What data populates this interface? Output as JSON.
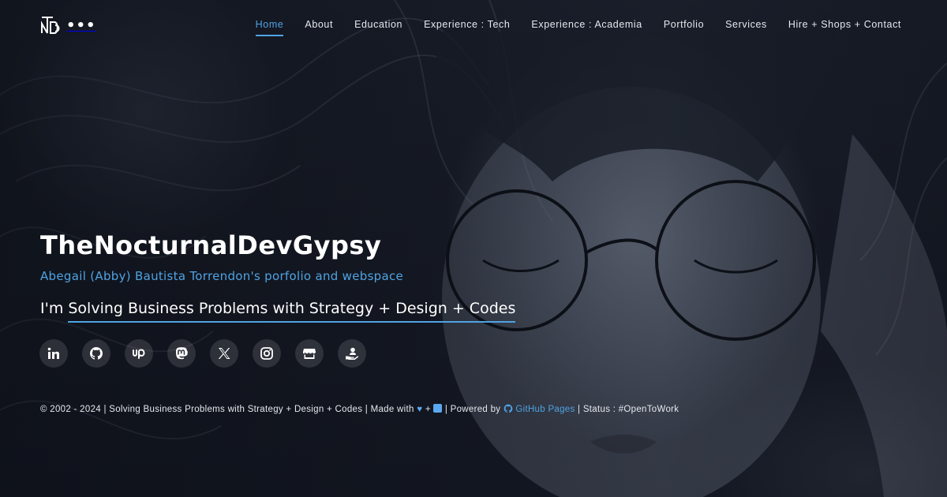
{
  "brand": {
    "logo_letters": "TNDG",
    "menu_dots": "•••"
  },
  "nav": {
    "items": [
      {
        "label": "Home",
        "active": true
      },
      {
        "label": "About"
      },
      {
        "label": "Education"
      },
      {
        "label": "Experience : Tech"
      },
      {
        "label": "Experience : Academia"
      },
      {
        "label": "Portfolio"
      },
      {
        "label": "Services"
      },
      {
        "label": "Hire + Shops + Contact"
      }
    ]
  },
  "hero": {
    "title": "TheNocturnalDevGypsy",
    "subtitle": "Abegail (Abby) Bautista Torrendon's porfolio and webspace",
    "tagline_prefix": "I'm ",
    "tagline_typed": "Solving Business Problems with Strategy + Design + Codes"
  },
  "social": [
    {
      "icon": "linkedin-icon"
    },
    {
      "icon": "github-icon"
    },
    {
      "icon": "upwork-icon"
    },
    {
      "icon": "mastodon-icon"
    },
    {
      "icon": "x-icon"
    },
    {
      "icon": "instagram-icon"
    },
    {
      "icon": "shop-icon"
    },
    {
      "icon": "hire-icon"
    }
  ],
  "footer": {
    "copyright": "© 2002 - 2024 | Solving Business Problems with Strategy + Design + Codes | Made with ",
    "plus": " + ",
    "powered_prefix": " | Powered by ",
    "powered_link": "GitHub Pages",
    "status": " | Status : #OpenToWork"
  },
  "colors": {
    "accent": "#4fa3e3",
    "text": "#ffffff",
    "background": "#121620"
  }
}
